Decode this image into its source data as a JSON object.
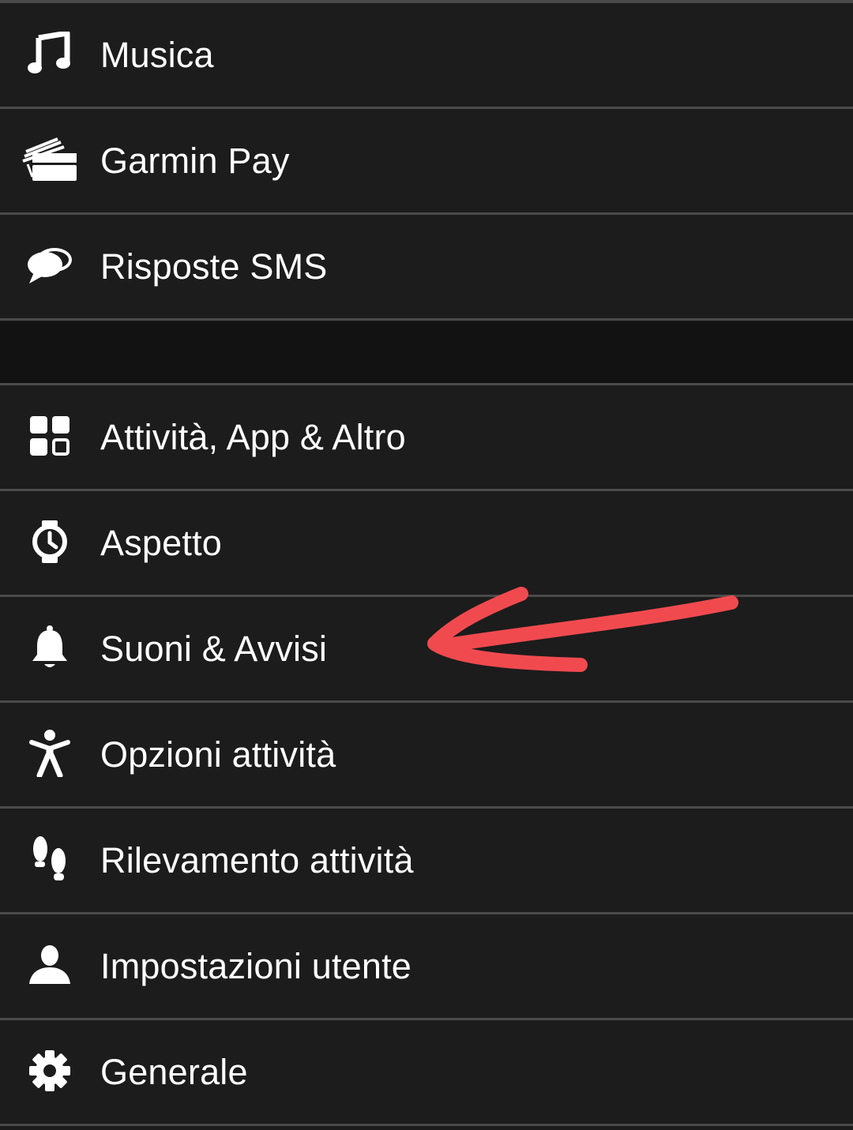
{
  "menu_group_1": [
    {
      "id": "musica",
      "label": "Musica",
      "icon": "music-note-icon"
    },
    {
      "id": "garmin-pay",
      "label": "Garmin Pay",
      "icon": "wallet-cards-icon"
    },
    {
      "id": "risposte-sms",
      "label": "Risposte SMS",
      "icon": "chat-bubbles-icon"
    }
  ],
  "menu_group_2": [
    {
      "id": "attivita-app",
      "label": "Attività, App & Altro",
      "icon": "grid-apps-icon"
    },
    {
      "id": "aspetto",
      "label": "Aspetto",
      "icon": "watch-face-icon"
    },
    {
      "id": "suoni-avvisi",
      "label": "Suoni & Avvisi",
      "icon": "bell-icon"
    },
    {
      "id": "opzioni-attivita",
      "label": "Opzioni attività",
      "icon": "running-person-icon"
    },
    {
      "id": "rilevamento-attivita",
      "label": "Rilevamento attività",
      "icon": "footprints-icon"
    },
    {
      "id": "impostazioni-utente",
      "label": "Impostazioni utente",
      "icon": "user-icon"
    },
    {
      "id": "generale",
      "label": "Generale",
      "icon": "gear-icon"
    }
  ],
  "annotation": {
    "arrow_color": "#f04a4f",
    "points_to": "suoni-avvisi"
  },
  "colors": {
    "background": "#1c1c1c",
    "divider": "#4a4a4a",
    "band": "#121212",
    "text": "#ffffff"
  }
}
